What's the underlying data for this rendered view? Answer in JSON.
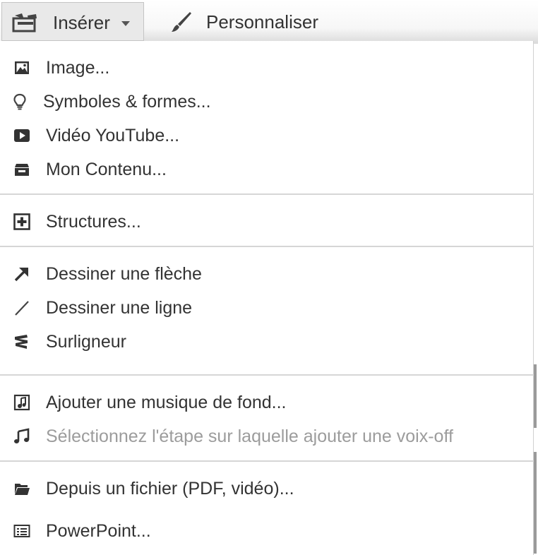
{
  "toolbar": {
    "insert_label": "Insérer",
    "customize_label": "Personnaliser"
  },
  "menu": {
    "groups": [
      [
        {
          "label": "Image...",
          "icon": "image-icon",
          "enabled": true
        },
        {
          "label": "Symboles & formes...",
          "icon": "lightbulb-icon",
          "enabled": true
        },
        {
          "label": "Vidéo YouTube...",
          "icon": "play-icon",
          "enabled": true
        },
        {
          "label": "Mon Contenu...",
          "icon": "archive-box-icon",
          "enabled": true
        }
      ],
      [
        {
          "label": "Structures...",
          "icon": "plus-square-icon",
          "enabled": true
        }
      ],
      [
        {
          "label": "Dessiner une flèche",
          "icon": "arrow-icon",
          "enabled": true
        },
        {
          "label": "Dessiner une ligne",
          "icon": "line-icon",
          "enabled": true
        },
        {
          "label": "Surligneur",
          "icon": "highlighter-icon",
          "enabled": true
        }
      ],
      [
        {
          "label": "Ajouter une musique de fond...",
          "icon": "music-file-icon",
          "enabled": true
        },
        {
          "label": "Sélectionnez l'étape sur laquelle ajouter une voix-off",
          "icon": "music-note-icon",
          "enabled": false
        }
      ],
      [
        {
          "label": "Depuis un fichier (PDF, vidéo)...",
          "icon": "folder-icon",
          "enabled": true
        },
        {
          "label": "PowerPoint...",
          "icon": "slides-icon",
          "enabled": true
        }
      ]
    ]
  }
}
